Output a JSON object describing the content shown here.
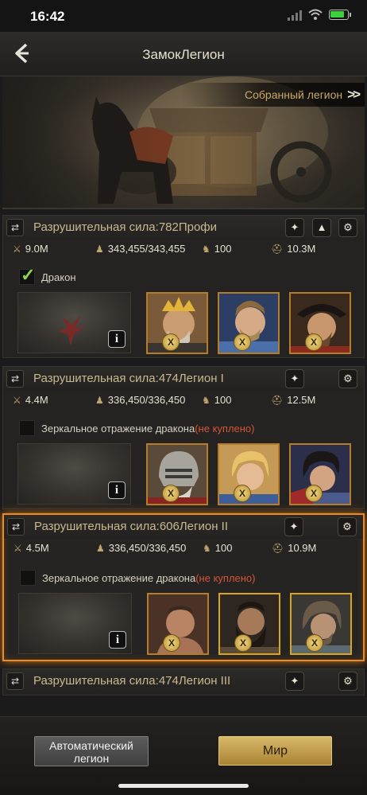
{
  "status_bar": {
    "time": "16:42",
    "battery_level": 0.85
  },
  "header": {
    "title": "ЗамокЛегион",
    "back_icon": "back-arrow-icon"
  },
  "banner": {
    "assembled_label": "Собранный легион",
    "assembled_icon": "double-chevron-right-icon"
  },
  "legions": [
    {
      "title": "Разрушительная сила:782Профи",
      "stats": {
        "troops": "9.0M",
        "capacity": "343,455/343,455",
        "count": "100",
        "power": "10.3M"
      },
      "dragon_label": "Дракон",
      "dragon_status": "",
      "dragon_checked": true,
      "heroes": [
        "knight-crown",
        "blue-warrior",
        "pirate-captain"
      ]
    },
    {
      "title": "Разрушительная сила:474Легион I",
      "stats": {
        "troops": "4.4M",
        "capacity": "336,450/336,450",
        "count": "100",
        "power": "12.5M"
      },
      "dragon_label": "Зеркальное отражение дракона",
      "dragon_status": "(не куплено)",
      "dragon_checked": false,
      "heroes": [
        "helmet-knight",
        "blond-prince",
        "dark-hair-warrior"
      ]
    },
    {
      "title": "Разрушительная сила:606Легион II",
      "stats": {
        "troops": "4.5M",
        "capacity": "336,450/336,450",
        "count": "100",
        "power": "10.9M"
      },
      "dragon_label": "Зеркальное отражение дракона",
      "dragon_status": "(не куплено)",
      "dragon_checked": false,
      "heroes": [
        "gladiator",
        "bearded-barbarian",
        "grey-ranger"
      ]
    },
    {
      "title": "Разрушительная сила:474Легион III"
    }
  ],
  "bottom": {
    "auto_legion_label": "Автоматический легион",
    "world_label": "Мир"
  },
  "colors": {
    "accent_orange": "#f08a1d",
    "gold": "#c9b890",
    "not_bought_red": "#d5553a"
  }
}
